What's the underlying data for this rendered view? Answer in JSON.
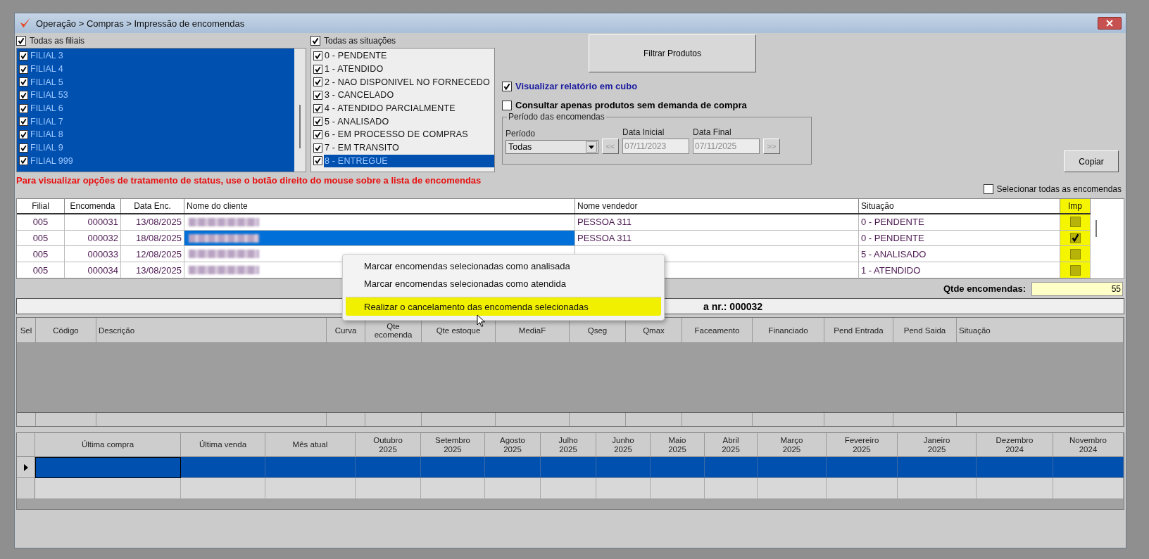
{
  "window": {
    "title": "Operação > Compras > Impressão de encomendas"
  },
  "filiais": {
    "all": {
      "label": "Todas as filiais",
      "checked": true
    },
    "items": [
      {
        "label": "FILIAL 3",
        "checked": true,
        "selected": true
      },
      {
        "label": "FILIAL 4",
        "checked": true,
        "selected": true
      },
      {
        "label": "FILIAL 5",
        "checked": true,
        "selected": true
      },
      {
        "label": "FILIAL 53",
        "checked": true,
        "selected": true
      },
      {
        "label": "FILIAL 6",
        "checked": true,
        "selected": true
      },
      {
        "label": "FILIAL 7",
        "checked": true,
        "selected": true
      },
      {
        "label": "FILIAL 8",
        "checked": true,
        "selected": true
      },
      {
        "label": "FILIAL 9",
        "checked": true,
        "selected": true
      },
      {
        "label": "FILIAL 999",
        "checked": true,
        "selected": true
      }
    ]
  },
  "situacoes": {
    "all": {
      "label": "Todas as situações",
      "checked": true
    },
    "items": [
      {
        "label": "0 - PENDENTE",
        "checked": true,
        "selected": false
      },
      {
        "label": "1 - ATENDIDO",
        "checked": true,
        "selected": false
      },
      {
        "label": "2 - NAO DISPONIVEL NO FORNECEDO",
        "checked": true,
        "selected": false
      },
      {
        "label": "3 - CANCELADO",
        "checked": true,
        "selected": false
      },
      {
        "label": "4 - ATENDIDO PARCIALMENTE",
        "checked": true,
        "selected": false
      },
      {
        "label": "5 - ANALISADO",
        "checked": true,
        "selected": false
      },
      {
        "label": "6 - EM PROCESSO DE COMPRAS",
        "checked": true,
        "selected": false
      },
      {
        "label": "7 - EM TRANSITO",
        "checked": true,
        "selected": false
      },
      {
        "label": "8 - ENTREGUE",
        "checked": true,
        "selected": true
      }
    ]
  },
  "filter_button": "Filtrar Produtos",
  "options": [
    {
      "label": "Visualizar relatório em cubo",
      "checked": true,
      "color": "#1a1aa0"
    },
    {
      "label": "Consultar apenas produtos sem demanda de compra",
      "checked": false,
      "color": "#000000"
    }
  ],
  "period": {
    "legend": "Período das encomendas",
    "period_label": "Período",
    "period_value": "Todas",
    "start_label": "Data Inicial",
    "start_value": "07/11/2023",
    "end_label": "Data Final",
    "end_value": "07/11/2025",
    "prev": "<<",
    "next": ">>",
    "disabled": true
  },
  "copy_button": "Copiar",
  "hint": "Para visualizar opções de tratamento de status, use o botão direito do mouse sobre a lista de encomendas",
  "select_all": {
    "label": "Selecionar todas as encomendas",
    "checked": false
  },
  "orders": {
    "imp_highlighted": true,
    "columns": [
      "Filial",
      "Encomenda",
      "Data Enc.",
      "Nome do cliente",
      "Nome vendedor",
      "Situação",
      "Imp"
    ],
    "rows": [
      {
        "filial": "005",
        "encomenda": "000031",
        "data": "13/08/2025",
        "vendedor": "PESSOA 311",
        "situacao": "0 - PENDENTE",
        "imp": false,
        "selected": false
      },
      {
        "filial": "005",
        "encomenda": "000032",
        "data": "18/08/2025",
        "vendedor": "PESSOA 311",
        "situacao": "0 - PENDENTE",
        "imp": true,
        "selected": true
      },
      {
        "filial": "005",
        "encomenda": "000033",
        "data": "12/08/2025",
        "situacao": "5 - ANALISADO",
        "imp": false,
        "selected": false
      },
      {
        "filial": "005",
        "encomenda": "000034",
        "data": "13/08/2025",
        "situacao": "1 - ATENDIDO",
        "imp": false,
        "selected": false
      }
    ]
  },
  "count": {
    "label": "Qtde encomendas:",
    "value": "55"
  },
  "products_heading": "a nr.: 000032",
  "products": {
    "columns": [
      {
        "label": "Sel"
      },
      {
        "label": "Código"
      },
      {
        "label": "Descrição"
      },
      {
        "label": "Curva"
      },
      {
        "label": "Qte",
        "sub": "ecomenda"
      },
      {
        "label": "Qte estoque"
      },
      {
        "label": "MediaF"
      },
      {
        "label": "Qseg"
      },
      {
        "label": "Qmax"
      },
      {
        "label": "Faceamento"
      },
      {
        "label": "Financiado"
      },
      {
        "label": "Pend Entrada"
      },
      {
        "label": "Pend Saida"
      },
      {
        "label": "Situação"
      }
    ]
  },
  "history": {
    "columns": [
      {
        "label": "Última compra"
      },
      {
        "label": "Última venda"
      },
      {
        "label": "Mês atual"
      },
      {
        "label": "Outubro",
        "sub": "2025"
      },
      {
        "label": "Setembro",
        "sub": "2025"
      },
      {
        "label": "Agosto",
        "sub": "2025"
      },
      {
        "label": "Julho",
        "sub": "2025"
      },
      {
        "label": "Junho",
        "sub": "2025"
      },
      {
        "label": "Maio",
        "sub": "2025"
      },
      {
        "label": "Abril",
        "sub": "2025"
      },
      {
        "label": "Março",
        "sub": "2025"
      },
      {
        "label": "Fevereiro",
        "sub": "2025"
      },
      {
        "label": "Janeiro",
        "sub": "2025"
      },
      {
        "label": "Dezembro",
        "sub": "2024"
      },
      {
        "label": "Novembro",
        "sub": "2024"
      }
    ],
    "rows": [
      {
        "current": true
      },
      {
        "current": false
      }
    ]
  },
  "context_menu": {
    "items": [
      {
        "label": "Marcar encomendas selecionadas como analisada",
        "highlighted": false,
        "separator_before": false
      },
      {
        "label": "Marcar encomendas selecionadas como atendida",
        "highlighted": false,
        "separator_before": false
      },
      {
        "label": "Realizar o cancelamento das encomenda selecionadas",
        "highlighted": true,
        "separator_before": true
      }
    ]
  }
}
